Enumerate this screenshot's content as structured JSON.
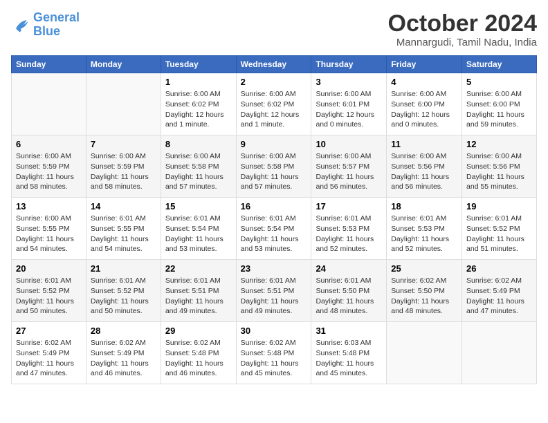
{
  "logo": {
    "line1": "General",
    "line2": "Blue"
  },
  "title": "October 2024",
  "location": "Mannargudi, Tamil Nadu, India",
  "weekdays": [
    "Sunday",
    "Monday",
    "Tuesday",
    "Wednesday",
    "Thursday",
    "Friday",
    "Saturday"
  ],
  "weeks": [
    [
      {
        "day": "",
        "info": ""
      },
      {
        "day": "",
        "info": ""
      },
      {
        "day": "1",
        "info": "Sunrise: 6:00 AM\nSunset: 6:02 PM\nDaylight: 12 hours\nand 1 minute."
      },
      {
        "day": "2",
        "info": "Sunrise: 6:00 AM\nSunset: 6:02 PM\nDaylight: 12 hours\nand 1 minute."
      },
      {
        "day": "3",
        "info": "Sunrise: 6:00 AM\nSunset: 6:01 PM\nDaylight: 12 hours\nand 0 minutes."
      },
      {
        "day": "4",
        "info": "Sunrise: 6:00 AM\nSunset: 6:00 PM\nDaylight: 12 hours\nand 0 minutes."
      },
      {
        "day": "5",
        "info": "Sunrise: 6:00 AM\nSunset: 6:00 PM\nDaylight: 11 hours\nand 59 minutes."
      }
    ],
    [
      {
        "day": "6",
        "info": "Sunrise: 6:00 AM\nSunset: 5:59 PM\nDaylight: 11 hours\nand 58 minutes."
      },
      {
        "day": "7",
        "info": "Sunrise: 6:00 AM\nSunset: 5:59 PM\nDaylight: 11 hours\nand 58 minutes."
      },
      {
        "day": "8",
        "info": "Sunrise: 6:00 AM\nSunset: 5:58 PM\nDaylight: 11 hours\nand 57 minutes."
      },
      {
        "day": "9",
        "info": "Sunrise: 6:00 AM\nSunset: 5:58 PM\nDaylight: 11 hours\nand 57 minutes."
      },
      {
        "day": "10",
        "info": "Sunrise: 6:00 AM\nSunset: 5:57 PM\nDaylight: 11 hours\nand 56 minutes."
      },
      {
        "day": "11",
        "info": "Sunrise: 6:00 AM\nSunset: 5:56 PM\nDaylight: 11 hours\nand 56 minutes."
      },
      {
        "day": "12",
        "info": "Sunrise: 6:00 AM\nSunset: 5:56 PM\nDaylight: 11 hours\nand 55 minutes."
      }
    ],
    [
      {
        "day": "13",
        "info": "Sunrise: 6:00 AM\nSunset: 5:55 PM\nDaylight: 11 hours\nand 54 minutes."
      },
      {
        "day": "14",
        "info": "Sunrise: 6:01 AM\nSunset: 5:55 PM\nDaylight: 11 hours\nand 54 minutes."
      },
      {
        "day": "15",
        "info": "Sunrise: 6:01 AM\nSunset: 5:54 PM\nDaylight: 11 hours\nand 53 minutes."
      },
      {
        "day": "16",
        "info": "Sunrise: 6:01 AM\nSunset: 5:54 PM\nDaylight: 11 hours\nand 53 minutes."
      },
      {
        "day": "17",
        "info": "Sunrise: 6:01 AM\nSunset: 5:53 PM\nDaylight: 11 hours\nand 52 minutes."
      },
      {
        "day": "18",
        "info": "Sunrise: 6:01 AM\nSunset: 5:53 PM\nDaylight: 11 hours\nand 52 minutes."
      },
      {
        "day": "19",
        "info": "Sunrise: 6:01 AM\nSunset: 5:52 PM\nDaylight: 11 hours\nand 51 minutes."
      }
    ],
    [
      {
        "day": "20",
        "info": "Sunrise: 6:01 AM\nSunset: 5:52 PM\nDaylight: 11 hours\nand 50 minutes."
      },
      {
        "day": "21",
        "info": "Sunrise: 6:01 AM\nSunset: 5:52 PM\nDaylight: 11 hours\nand 50 minutes."
      },
      {
        "day": "22",
        "info": "Sunrise: 6:01 AM\nSunset: 5:51 PM\nDaylight: 11 hours\nand 49 minutes."
      },
      {
        "day": "23",
        "info": "Sunrise: 6:01 AM\nSunset: 5:51 PM\nDaylight: 11 hours\nand 49 minutes."
      },
      {
        "day": "24",
        "info": "Sunrise: 6:01 AM\nSunset: 5:50 PM\nDaylight: 11 hours\nand 48 minutes."
      },
      {
        "day": "25",
        "info": "Sunrise: 6:02 AM\nSunset: 5:50 PM\nDaylight: 11 hours\nand 48 minutes."
      },
      {
        "day": "26",
        "info": "Sunrise: 6:02 AM\nSunset: 5:49 PM\nDaylight: 11 hours\nand 47 minutes."
      }
    ],
    [
      {
        "day": "27",
        "info": "Sunrise: 6:02 AM\nSunset: 5:49 PM\nDaylight: 11 hours\nand 47 minutes."
      },
      {
        "day": "28",
        "info": "Sunrise: 6:02 AM\nSunset: 5:49 PM\nDaylight: 11 hours\nand 46 minutes."
      },
      {
        "day": "29",
        "info": "Sunrise: 6:02 AM\nSunset: 5:48 PM\nDaylight: 11 hours\nand 46 minutes."
      },
      {
        "day": "30",
        "info": "Sunrise: 6:02 AM\nSunset: 5:48 PM\nDaylight: 11 hours\nand 45 minutes."
      },
      {
        "day": "31",
        "info": "Sunrise: 6:03 AM\nSunset: 5:48 PM\nDaylight: 11 hours\nand 45 minutes."
      },
      {
        "day": "",
        "info": ""
      },
      {
        "day": "",
        "info": ""
      }
    ]
  ]
}
